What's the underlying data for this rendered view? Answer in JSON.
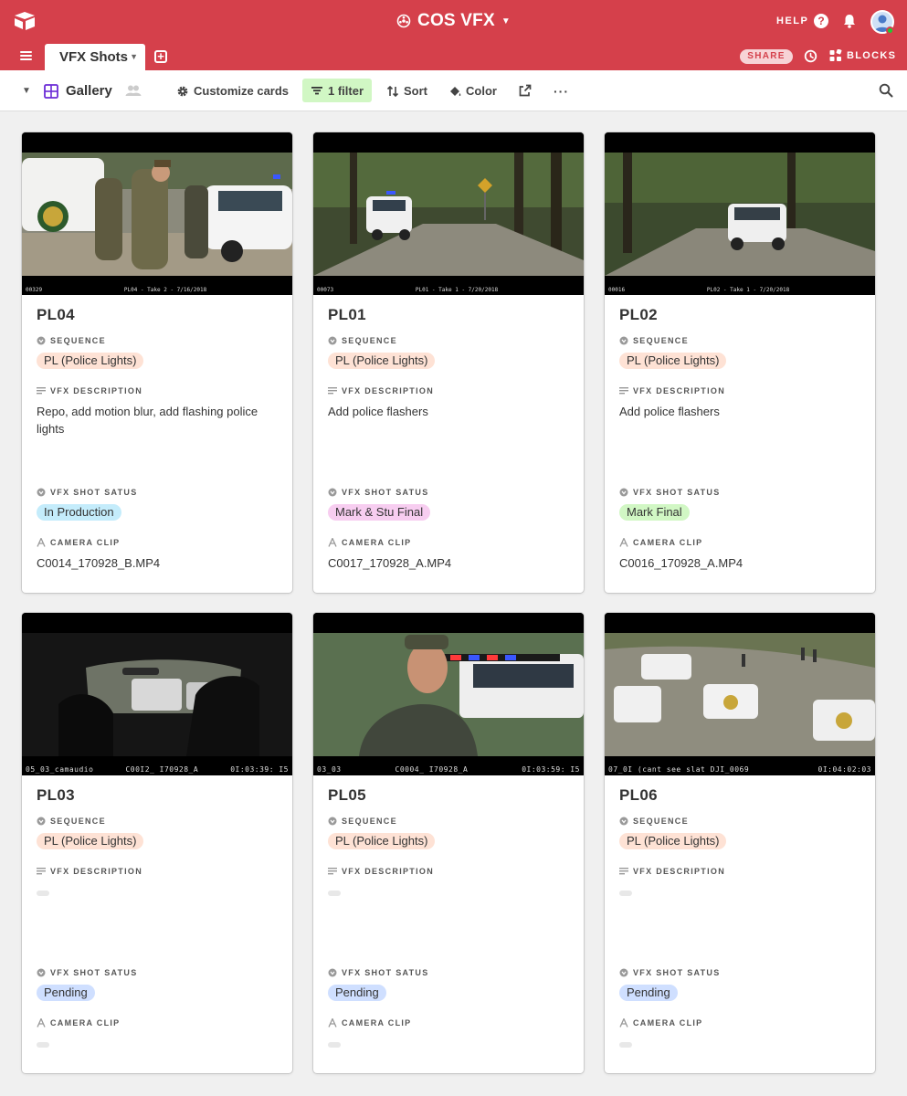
{
  "topbar": {
    "base_name": "COS VFX",
    "help_label": "HELP",
    "help_glyph": "?",
    "table_tab": "VFX Shots",
    "share_label": "SHARE",
    "blocks_label": "BLOCKS",
    "accent_color": "#d5404b"
  },
  "viewbar": {
    "view_name": "Gallery",
    "customize_label": "Customize cards",
    "filter_label": "1 filter",
    "sort_label": "Sort",
    "color_label": "Color",
    "more_label": "···"
  },
  "field_labels": {
    "sequence": "SEQUENCE",
    "description": "VFX DESCRIPTION",
    "status": "VFX SHOT SATUS",
    "clip": "CAMERA CLIP"
  },
  "cards": [
    {
      "title": "PL04",
      "sequence": "PL (Police Lights)",
      "description": "Repo, add motion blur, add flashing police lights",
      "status": "In Production",
      "status_color": "#c4ecfb",
      "clip": "C0014_170928_B.MP4",
      "tc_left": "00329",
      "tc_mid": "PL04 - Take 2 - 7/16/2018",
      "tc_right": ""
    },
    {
      "title": "PL01",
      "sequence": "PL (Police Lights)",
      "description": "Add police flashers",
      "status": "Mark & Stu Final",
      "status_color": "#f7cdf0",
      "clip": "C0017_170928_A.MP4",
      "tc_left": "00073",
      "tc_mid": "PL01 - Take 1 - 7/20/2018",
      "tc_right": ""
    },
    {
      "title": "PL02",
      "sequence": "PL (Police Lights)",
      "description": "Add police flashers",
      "status": "Mark Final",
      "status_color": "#d1f7c4",
      "clip": "C0016_170928_A.MP4",
      "tc_left": "00016",
      "tc_mid": "PL02 - Take 1 - 7/20/2018",
      "tc_right": ""
    },
    {
      "title": "PL03",
      "sequence": "PL (Police Lights)",
      "description": "",
      "status": "Pending",
      "status_color": "#cfdfff",
      "clip": "",
      "tc_left": "05_03_camaudio",
      "tc_mid": "C00I2_ I70928_A",
      "tc_right": "0I:03:39: I5"
    },
    {
      "title": "PL05",
      "sequence": "PL (Police Lights)",
      "description": "",
      "status": "Pending",
      "status_color": "#cfdfff",
      "clip": "",
      "tc_left": "03_03",
      "tc_mid": "C0004_ I70928_A",
      "tc_right": "0I:03:59: I5"
    },
    {
      "title": "PL06",
      "sequence": "PL (Police Lights)",
      "description": "",
      "status": "Pending",
      "status_color": "#cfdfff",
      "clip": "",
      "tc_left": "07_0I (cant see slat DJI_0069",
      "tc_mid": "",
      "tc_right": "0I:04:02:03"
    }
  ],
  "sequence_color": "#fee2d5"
}
